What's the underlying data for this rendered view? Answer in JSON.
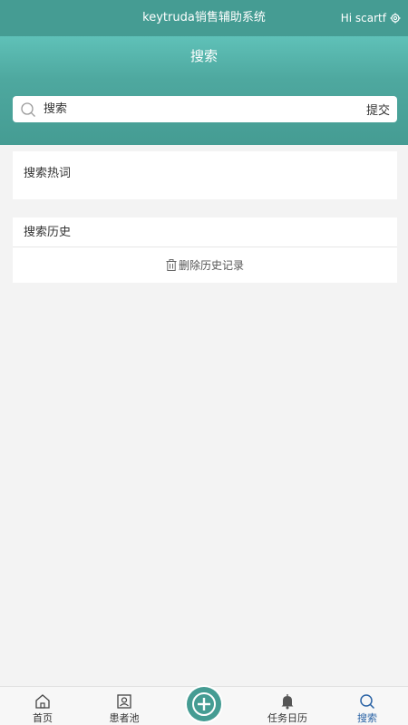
{
  "top_bar": {
    "app_title": "keytruda销售辅助系统",
    "user_greeting": "Hi scartf"
  },
  "header": {
    "page_title": "搜索"
  },
  "search": {
    "placeholder": "搜索",
    "submit_label": "提交"
  },
  "hot_words": {
    "title": "搜索热词"
  },
  "history": {
    "title": "搜索历史",
    "delete_label": "删除历史记录"
  },
  "bottom_nav": {
    "items": [
      {
        "label": "首页",
        "icon": "home-icon"
      },
      {
        "label": "患者池",
        "icon": "patient-pool-icon"
      },
      {
        "label": "",
        "icon": "add-icon"
      },
      {
        "label": "任务日历",
        "icon": "bell-icon"
      },
      {
        "label": "搜索",
        "icon": "search-icon",
        "active": true
      }
    ]
  },
  "colors": {
    "brand": "#459c93",
    "active_nav": "#2a63a5",
    "background": "#f3f3f3"
  }
}
